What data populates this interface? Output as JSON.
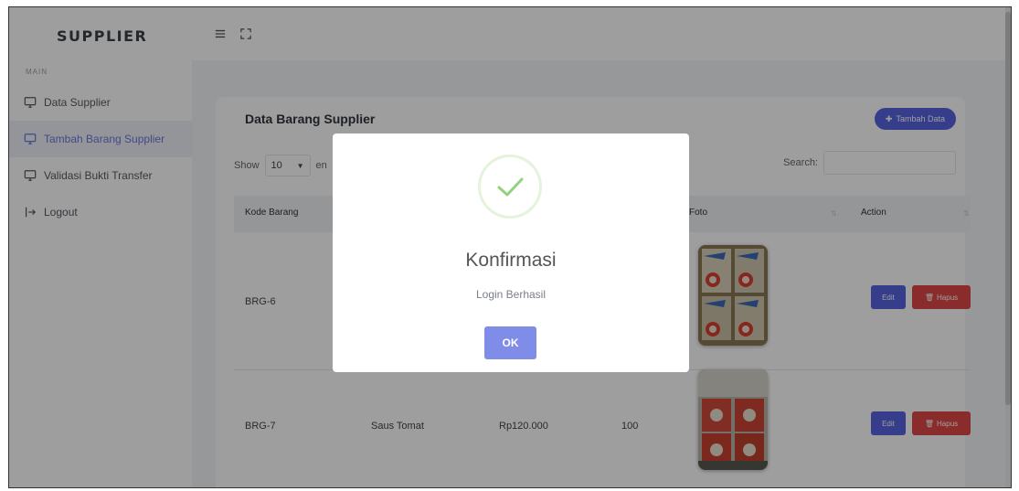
{
  "sidebar": {
    "brand": "SUPPLIER",
    "section_label": "MAIN",
    "items": [
      {
        "label": "Data Supplier",
        "icon": "monitor-icon"
      },
      {
        "label": "Tambah Barang Supplier",
        "icon": "monitor-icon",
        "active": true
      },
      {
        "label": "Validasi Bukti Transfer",
        "icon": "monitor-icon"
      },
      {
        "label": "Logout",
        "icon": "logout-icon"
      }
    ]
  },
  "topbar": {
    "menu_icon": "hamburger-icon",
    "fullscreen_icon": "expand-icon"
  },
  "card": {
    "title": "Data Barang Supplier",
    "add_button": "Tambah Data",
    "show_label": "Show",
    "show_value": "10",
    "entries_label": "en",
    "search_label": "Search:"
  },
  "table": {
    "columns": [
      "Kode Barang",
      "Foto",
      "Action"
    ],
    "rows": [
      {
        "kode": "BRG-6",
        "nama": "",
        "harga": "",
        "stok": ""
      },
      {
        "kode": "BRG-7",
        "nama": "Saus Tomat",
        "harga": "Rp120.000",
        "stok": "100"
      }
    ],
    "edit_label": "Edit",
    "delete_label": "Hapus"
  },
  "modal": {
    "title": "Konfirmasi",
    "message": "Login Berhasil",
    "ok_label": "OK",
    "icon": "check-icon"
  },
  "colors": {
    "primary": "#5865e0",
    "danger": "#e04848",
    "success": "#8fd37a",
    "ok_button": "#7f8ce8"
  }
}
